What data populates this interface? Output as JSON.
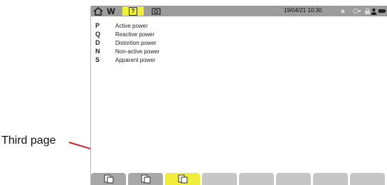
{
  "callout": {
    "label": "Third page"
  },
  "topbar": {
    "home_icon": "home-icon",
    "mode_label": "W",
    "help_icon": "help-icon",
    "help_glyph": "?",
    "camera_icon": "camera-icon",
    "datetime": "19/04/21 10:30"
  },
  "legend": {
    "items": [
      {
        "symbol": "P",
        "label": "Active power"
      },
      {
        "symbol": "Q",
        "label": "Reactive power"
      },
      {
        "symbol": "D",
        "label": "Distortion power"
      },
      {
        "symbol": "N",
        "label": "Non-active power"
      },
      {
        "symbol": "S",
        "label": "Apparent power"
      }
    ]
  },
  "bottombar": {
    "tabs": [
      {
        "icon": "page-icon",
        "state": "default"
      },
      {
        "icon": "page-icon",
        "state": "default"
      },
      {
        "icon": "page-icon",
        "state": "selected"
      },
      {
        "icon": "",
        "state": "empty"
      },
      {
        "icon": "",
        "state": "empty"
      },
      {
        "icon": "",
        "state": "empty"
      },
      {
        "icon": "",
        "state": "empty"
      },
      {
        "icon": "",
        "state": "empty"
      }
    ]
  },
  "colors": {
    "highlight": "#f0ee3a",
    "bar": "#9c9c9c",
    "arrow": "#c0272d"
  }
}
